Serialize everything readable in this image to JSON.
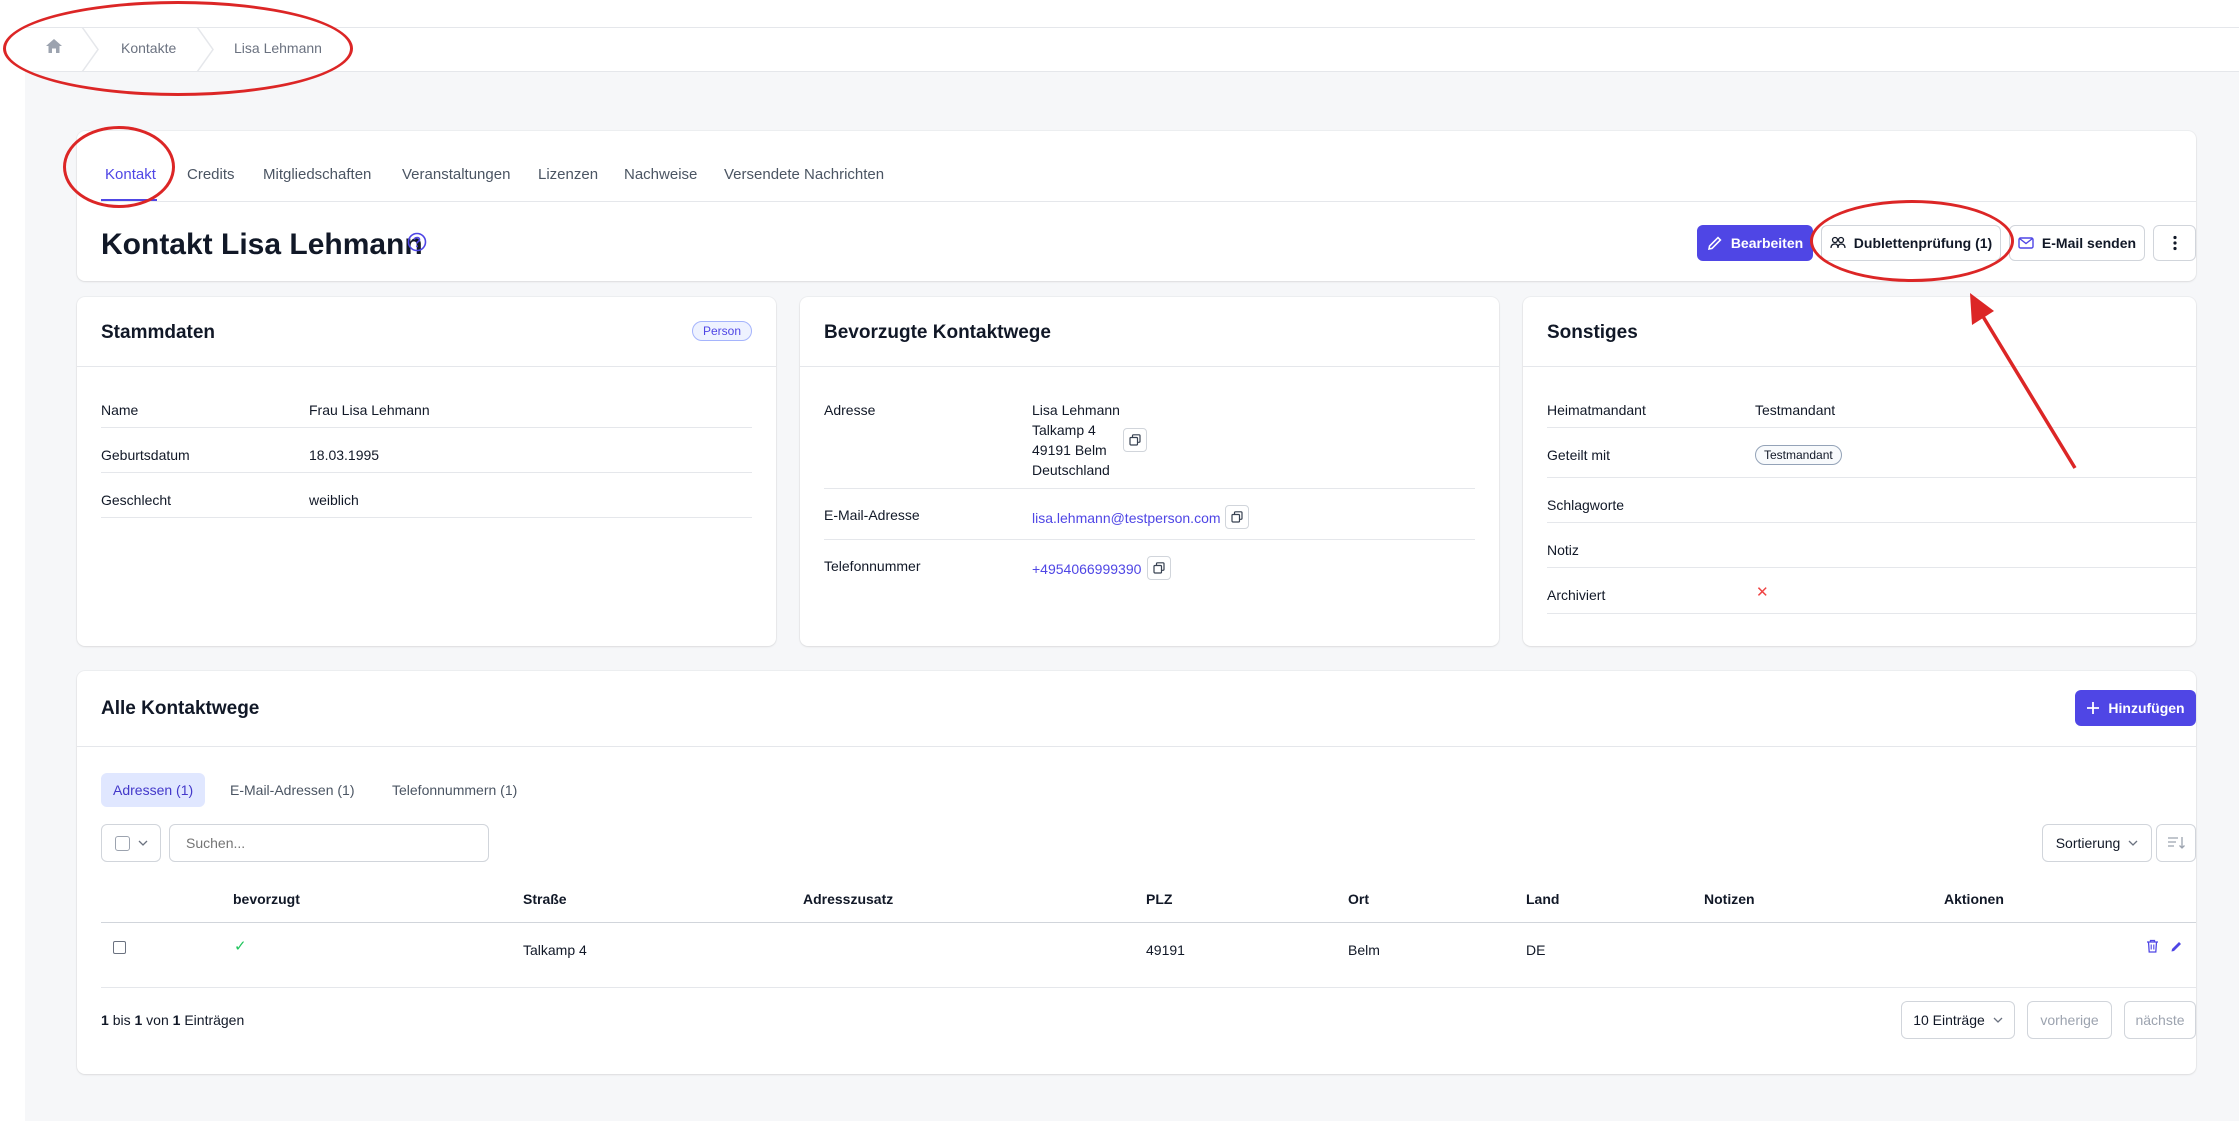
{
  "breadcrumb": {
    "items": [
      "Kontakte",
      "Lisa Lehmann"
    ]
  },
  "tabs": [
    "Kontakt",
    "Credits",
    "Mitgliedschaften",
    "Veranstaltungen",
    "Lizenzen",
    "Nachweise",
    "Versendete Nachrichten"
  ],
  "header": {
    "title": "Kontakt Lisa Lehmann",
    "edit_label": "Bearbeiten",
    "duplicate_label": "Dublettenprüfung (1)",
    "email_label": "E-Mail senden"
  },
  "stammdaten": {
    "title": "Stammdaten",
    "badge": "Person",
    "rows": [
      {
        "label": "Name",
        "value": "Frau Lisa Lehmann"
      },
      {
        "label": "Geburtsdatum",
        "value": "18.03.1995"
      },
      {
        "label": "Geschlecht",
        "value": "weiblich"
      }
    ]
  },
  "kontaktwege": {
    "title": "Bevorzugte Kontaktwege",
    "address_label": "Adresse",
    "address_lines": [
      "Lisa Lehmann",
      "Talkamp 4",
      "49191 Belm",
      "Deutschland"
    ],
    "email_label": "E-Mail-Adresse",
    "email": "lisa.lehmann@testperson.com",
    "phone_label": "Telefonnummer",
    "phone": "+4954066999390"
  },
  "sonstiges": {
    "title": "Sonstiges",
    "home_label": "Heimatmandant",
    "home_value": "Testmandant",
    "shared_label": "Geteilt mit",
    "shared_value": "Testmandant",
    "tags_label": "Schlagworte",
    "note_label": "Notiz",
    "archived_label": "Archiviert",
    "archived_value": "✕"
  },
  "alle": {
    "title": "Alle Kontaktwege",
    "add_label": "Hinzufügen",
    "subtabs": [
      "Adressen (1)",
      "E-Mail-Adressen (1)",
      "Telefonnummern (1)"
    ],
    "search_placeholder": "Suchen...",
    "sort_label": "Sortierung",
    "columns": [
      "bevorzugt",
      "Straße",
      "Adresszusatz",
      "PLZ",
      "Ort",
      "Land",
      "Notizen",
      "Aktionen"
    ],
    "row": {
      "preferred": "✓",
      "street": "Talkamp 4",
      "extra": "",
      "zip": "49191",
      "city": "Belm",
      "country": "DE",
      "notes": ""
    },
    "footer": {
      "from": "1",
      "to_word": "bis",
      "to": "1",
      "of_word": "von",
      "total": "1",
      "suffix": "Einträgen"
    },
    "per_page": "10 Einträge",
    "prev": "vorherige",
    "next": "nächste"
  },
  "colors": {
    "accent": "#4f46e5",
    "annotation": "#dc2626"
  }
}
